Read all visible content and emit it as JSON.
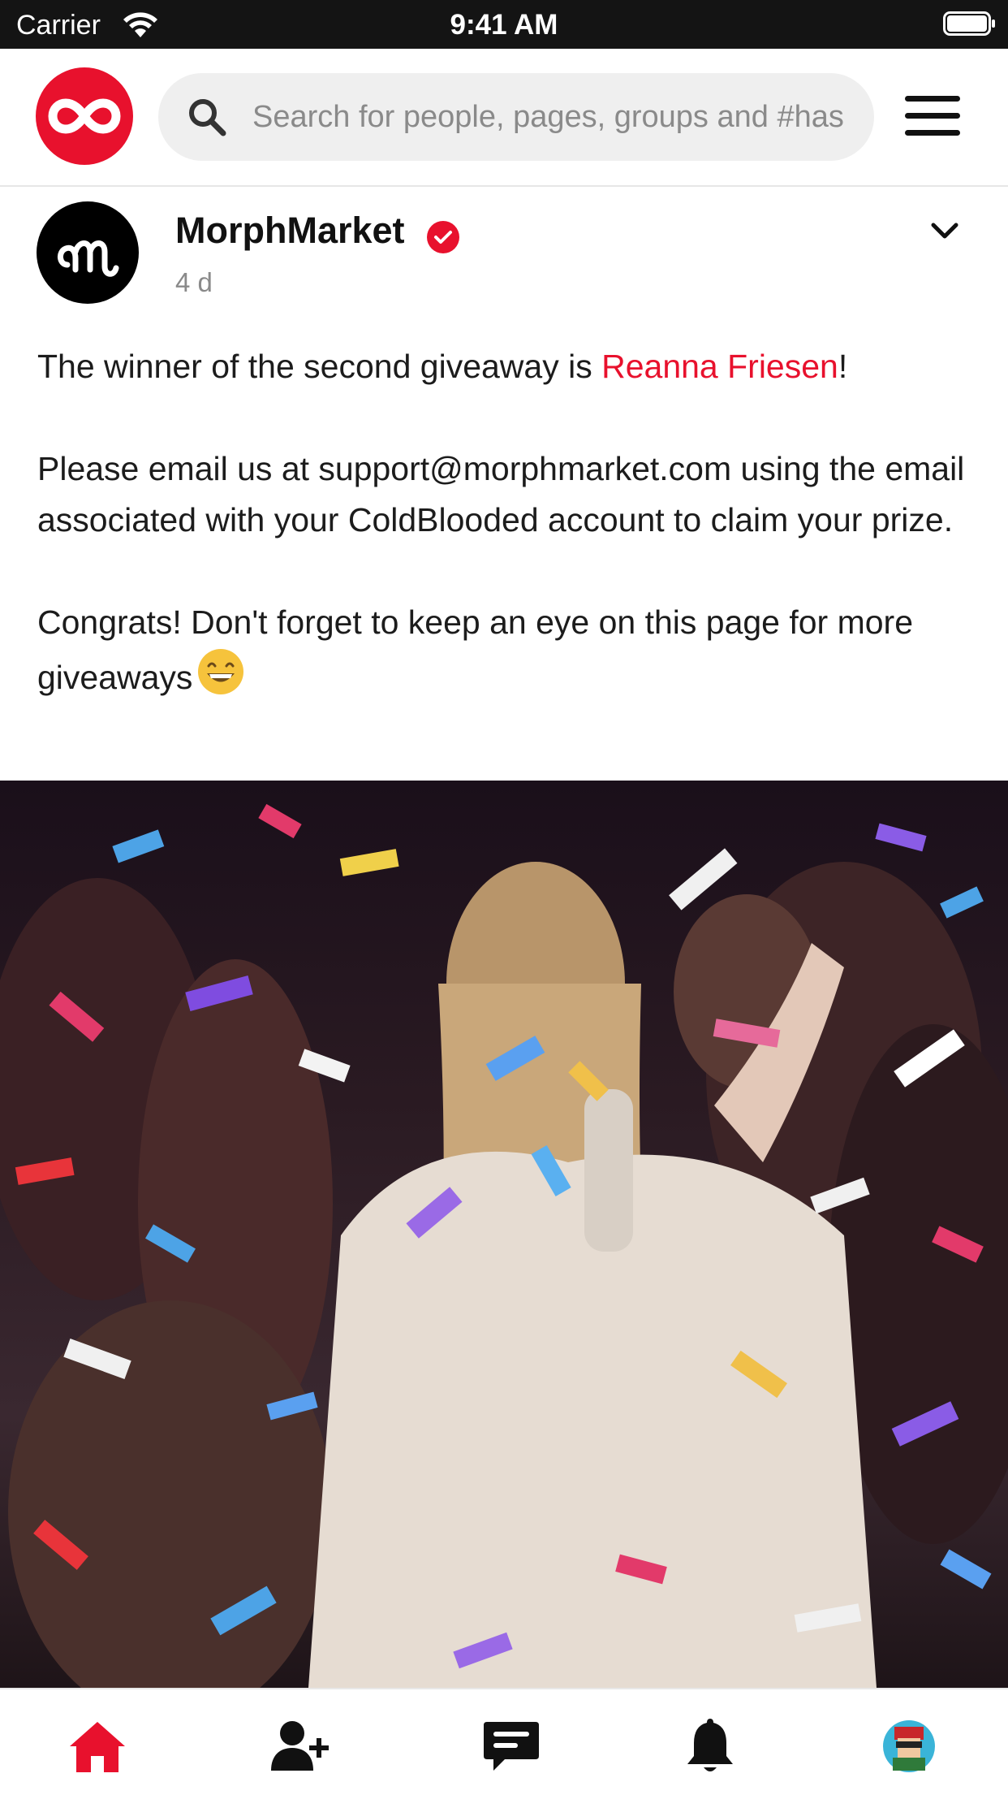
{
  "status_bar": {
    "carrier": "Carrier",
    "time": "9:41 AM"
  },
  "header": {
    "logo_icon": "infinity-logo-icon",
    "search_placeholder": "Search for people, pages, groups and #hashtags",
    "menu_icon": "hamburger-menu-icon"
  },
  "post": {
    "author": "MorphMarket",
    "verified_icon": "verified-badge-icon",
    "time": "4 d",
    "text": {
      "line1_before": "The winner of the second giveaway is ",
      "mention": "Reanna Friesen",
      "line1_after": "!",
      "paragraph2": "Please email us at support@morphmarket.com using the email associated with your ColdBlooded account to claim your prize.",
      "paragraph3": "Congrats! Don't forget to keep an eye on this page for more giveaways",
      "emoji": "grinning-face-emoji"
    },
    "media_description_icon": "confetti-gif-image"
  },
  "tabbar": {
    "items": [
      {
        "icon": "home-icon",
        "active": true
      },
      {
        "icon": "add-friend-icon",
        "active": false
      },
      {
        "icon": "messages-icon",
        "active": false
      },
      {
        "icon": "notifications-bell-icon",
        "active": false
      },
      {
        "icon": "profile-avatar-icon",
        "active": false
      }
    ]
  },
  "colors": {
    "accent": "#e8112d",
    "status_bar_bg": "#141414",
    "search_bg": "#efefef",
    "text": "#1c1c1c",
    "muted": "#8a8a8a"
  }
}
